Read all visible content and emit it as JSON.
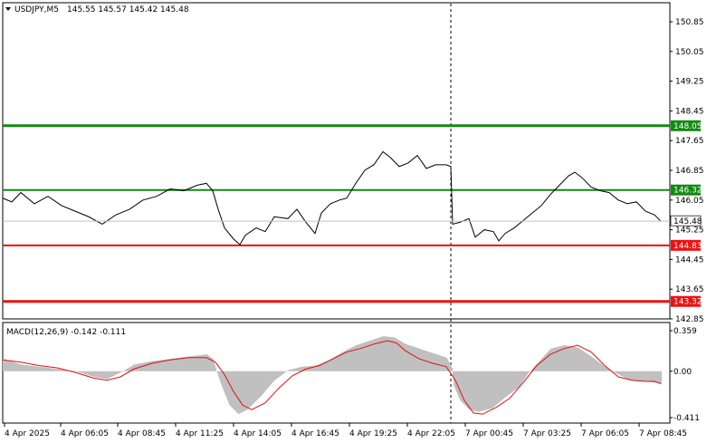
{
  "header": {
    "symbol_label": "USDJPY,M5",
    "ohlc_text": "145.55 145.57 145.42 145.48",
    "menu_icon": "triangle-down-icon"
  },
  "price_axis": {
    "labels": [
      "150.85",
      "150.05",
      "149.25",
      "148.45",
      "147.65",
      "146.85",
      "146.05",
      "145.25",
      "144.45",
      "143.65",
      "142.85"
    ],
    "ylim": [
      142.85,
      150.85
    ]
  },
  "levels": [
    {
      "value": 148.05,
      "label": "148.05",
      "color": "#138a13",
      "kind": "resistance"
    },
    {
      "value": 146.32,
      "label": "146.32",
      "color": "#138a13",
      "kind": "resistance"
    },
    {
      "value": 144.83,
      "label": "144.83",
      "color": "#ee1111",
      "kind": "support"
    },
    {
      "value": 143.32,
      "label": "143.32",
      "color": "#ee1111",
      "kind": "support"
    }
  ],
  "current_price": {
    "value": 145.48,
    "label": "145.48"
  },
  "macd": {
    "title": "MACD(12,26,9) -0.142 -0.111",
    "axis_labels": [
      "0.359",
      "0.00",
      "-0.411"
    ],
    "ylim": [
      -0.411,
      0.359
    ]
  },
  "time_axis": {
    "labels": [
      "4 Apr 2025",
      "4 Apr 06:05",
      "4 Apr 08:45",
      "4 Apr 11:25",
      "4 Apr 14:05",
      "4 Apr 16:45",
      "4 Apr 19:25",
      "4 Apr 22:05",
      "7 Apr 00:45",
      "7 Apr 03:25",
      "7 Apr 06:05",
      "7 Apr 08:45"
    ]
  },
  "chart_data": {
    "type": "line",
    "symbol": "USDJPY",
    "timeframe": "M5",
    "price_series": [
      [
        0,
        146.1
      ],
      [
        10,
        146.0
      ],
      [
        20,
        146.25
      ],
      [
        35,
        145.95
      ],
      [
        50,
        146.15
      ],
      [
        65,
        145.9
      ],
      [
        80,
        145.75
      ],
      [
        95,
        145.6
      ],
      [
        110,
        145.4
      ],
      [
        125,
        145.65
      ],
      [
        140,
        145.8
      ],
      [
        155,
        146.05
      ],
      [
        170,
        146.15
      ],
      [
        185,
        146.35
      ],
      [
        200,
        146.3
      ],
      [
        215,
        146.45
      ],
      [
        225,
        146.5
      ],
      [
        232,
        146.3
      ],
      [
        238,
        145.8
      ],
      [
        245,
        145.3
      ],
      [
        255,
        145.0
      ],
      [
        262,
        144.85
      ],
      [
        268,
        145.1
      ],
      [
        280,
        145.3
      ],
      [
        290,
        145.2
      ],
      [
        300,
        145.6
      ],
      [
        315,
        145.55
      ],
      [
        325,
        145.8
      ],
      [
        335,
        145.45
      ],
      [
        345,
        145.15
      ],
      [
        352,
        145.7
      ],
      [
        362,
        145.95
      ],
      [
        372,
        146.05
      ],
      [
        380,
        146.1
      ],
      [
        390,
        146.5
      ],
      [
        400,
        146.85
      ],
      [
        410,
        147.0
      ],
      [
        420,
        147.35
      ],
      [
        428,
        147.2
      ],
      [
        438,
        146.95
      ],
      [
        448,
        147.05
      ],
      [
        458,
        147.25
      ],
      [
        468,
        146.9
      ],
      [
        478,
        147.0
      ],
      [
        490,
        147.0
      ],
      [
        495,
        146.95
      ],
      [
        497,
        145.4
      ],
      [
        505,
        145.45
      ],
      [
        515,
        145.55
      ],
      [
        522,
        145.05
      ],
      [
        532,
        145.25
      ],
      [
        542,
        145.2
      ],
      [
        548,
        144.95
      ],
      [
        555,
        145.15
      ],
      [
        565,
        145.3
      ],
      [
        575,
        145.5
      ],
      [
        585,
        145.7
      ],
      [
        595,
        145.9
      ],
      [
        605,
        146.2
      ],
      [
        615,
        146.45
      ],
      [
        625,
        146.7
      ],
      [
        632,
        146.8
      ],
      [
        640,
        146.65
      ],
      [
        650,
        146.4
      ],
      [
        660,
        146.3
      ],
      [
        670,
        146.25
      ],
      [
        680,
        146.05
      ],
      [
        690,
        145.95
      ],
      [
        700,
        146.0
      ],
      [
        710,
        145.75
      ],
      [
        720,
        145.65
      ],
      [
        727,
        145.48
      ]
    ],
    "macd_histogram": [
      [
        0,
        0.11
      ],
      [
        20,
        0.06
      ],
      [
        40,
        0.04
      ],
      [
        60,
        0.02
      ],
      [
        80,
        0.0
      ],
      [
        100,
        -0.05
      ],
      [
        115,
        -0.07
      ],
      [
        130,
        -0.01
      ],
      [
        145,
        0.06
      ],
      [
        165,
        0.09
      ],
      [
        185,
        0.11
      ],
      [
        205,
        0.13
      ],
      [
        225,
        0.15
      ],
      [
        232,
        0.11
      ],
      [
        240,
        -0.1
      ],
      [
        250,
        -0.3
      ],
      [
        260,
        -0.38
      ],
      [
        270,
        -0.34
      ],
      [
        285,
        -0.22
      ],
      [
        300,
        -0.08
      ],
      [
        315,
        0.01
      ],
      [
        330,
        0.04
      ],
      [
        345,
        0.05
      ],
      [
        360,
        0.1
      ],
      [
        375,
        0.17
      ],
      [
        390,
        0.23
      ],
      [
        405,
        0.27
      ],
      [
        420,
        0.31
      ],
      [
        432,
        0.3
      ],
      [
        445,
        0.24
      ],
      [
        460,
        0.2
      ],
      [
        475,
        0.16
      ],
      [
        490,
        0.12
      ],
      [
        496,
        0.03
      ],
      [
        498,
        -0.13
      ],
      [
        505,
        -0.26
      ],
      [
        515,
        -0.34
      ],
      [
        525,
        -0.36
      ],
      [
        540,
        -0.33
      ],
      [
        555,
        -0.23
      ],
      [
        570,
        -0.14
      ],
      [
        580,
        -0.02
      ],
      [
        590,
        0.07
      ],
      [
        605,
        0.2
      ],
      [
        620,
        0.23
      ],
      [
        635,
        0.21
      ],
      [
        650,
        0.13
      ],
      [
        665,
        0.04
      ],
      [
        675,
        -0.01
      ],
      [
        690,
        -0.07
      ],
      [
        705,
        -0.09
      ],
      [
        720,
        -0.1
      ],
      [
        727,
        -0.11
      ]
    ],
    "macd_signal": [
      [
        0,
        0.1
      ],
      [
        20,
        0.08
      ],
      [
        40,
        0.05
      ],
      [
        60,
        0.03
      ],
      [
        80,
        -0.01
      ],
      [
        100,
        -0.06
      ],
      [
        115,
        -0.08
      ],
      [
        130,
        -0.05
      ],
      [
        145,
        0.02
      ],
      [
        165,
        0.07
      ],
      [
        185,
        0.1
      ],
      [
        205,
        0.12
      ],
      [
        225,
        0.12
      ],
      [
        235,
        0.08
      ],
      [
        245,
        -0.03
      ],
      [
        255,
        -0.18
      ],
      [
        265,
        -0.3
      ],
      [
        275,
        -0.34
      ],
      [
        290,
        -0.28
      ],
      [
        305,
        -0.15
      ],
      [
        320,
        -0.04
      ],
      [
        335,
        0.02
      ],
      [
        350,
        0.05
      ],
      [
        365,
        0.11
      ],
      [
        380,
        0.17
      ],
      [
        395,
        0.2
      ],
      [
        410,
        0.24
      ],
      [
        425,
        0.27
      ],
      [
        435,
        0.25
      ],
      [
        445,
        0.18
      ],
      [
        460,
        0.11
      ],
      [
        475,
        0.07
      ],
      [
        490,
        0.04
      ],
      [
        500,
        -0.08
      ],
      [
        510,
        -0.26
      ],
      [
        520,
        -0.37
      ],
      [
        530,
        -0.38
      ],
      [
        545,
        -0.32
      ],
      [
        560,
        -0.24
      ],
      [
        575,
        -0.1
      ],
      [
        590,
        0.05
      ],
      [
        605,
        0.15
      ],
      [
        620,
        0.2
      ],
      [
        635,
        0.23
      ],
      [
        650,
        0.17
      ],
      [
        665,
        0.05
      ],
      [
        680,
        -0.05
      ],
      [
        695,
        -0.08
      ],
      [
        710,
        -0.09
      ],
      [
        720,
        -0.09
      ],
      [
        727,
        -0.111
      ]
    ]
  }
}
